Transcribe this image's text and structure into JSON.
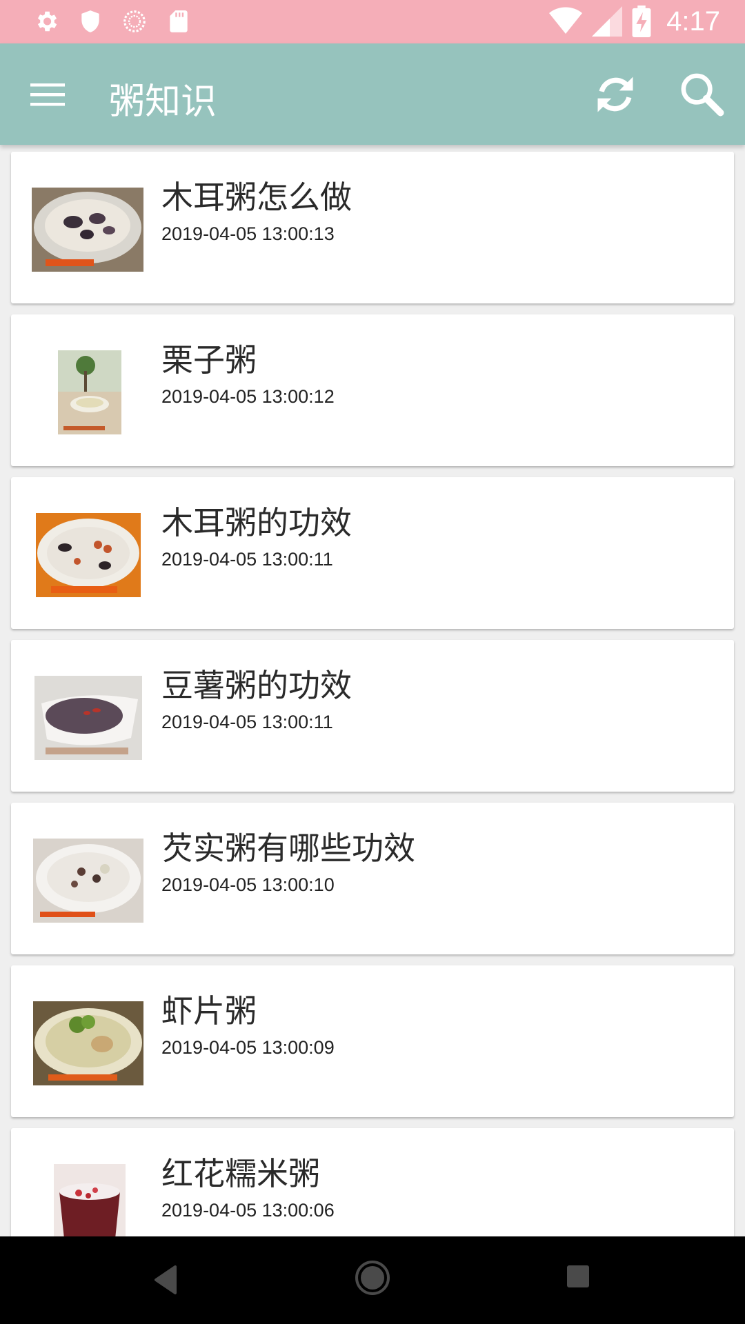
{
  "status_bar": {
    "time": "4:17",
    "left_icons": [
      "settings-icon",
      "shield-icon",
      "sync-circle-icon",
      "sd-card-icon"
    ],
    "right_icons": [
      "wifi-icon",
      "signal-icon",
      "battery-charging-icon"
    ]
  },
  "app_bar": {
    "title": "粥知识",
    "menu_icon": "menu-icon",
    "refresh_icon": "refresh-icon",
    "search_icon": "search-icon",
    "background_color": "#96c3bd"
  },
  "articles": [
    {
      "title": "木耳粥怎么做",
      "date": "2019-04-05 13:00:13"
    },
    {
      "title": "栗子粥",
      "date": "2019-04-05 13:00:12"
    },
    {
      "title": "木耳粥的功效",
      "date": "2019-04-05 13:00:11"
    },
    {
      "title": "豆薯粥的功效",
      "date": "2019-04-05 13:00:11"
    },
    {
      "title": "芡实粥有哪些功效",
      "date": "2019-04-05 13:00:10"
    },
    {
      "title": "虾片粥",
      "date": "2019-04-05 13:00:09"
    },
    {
      "title": "红花糯米粥",
      "date": "2019-04-05 13:00:06"
    }
  ],
  "nav_bar": {
    "back_icon": "back-triangle-icon",
    "home_icon": "home-circle-icon",
    "recents_icon": "recents-square-icon"
  },
  "colors": {
    "status_bar": "#f5aeb8",
    "list_background": "#efefef"
  }
}
